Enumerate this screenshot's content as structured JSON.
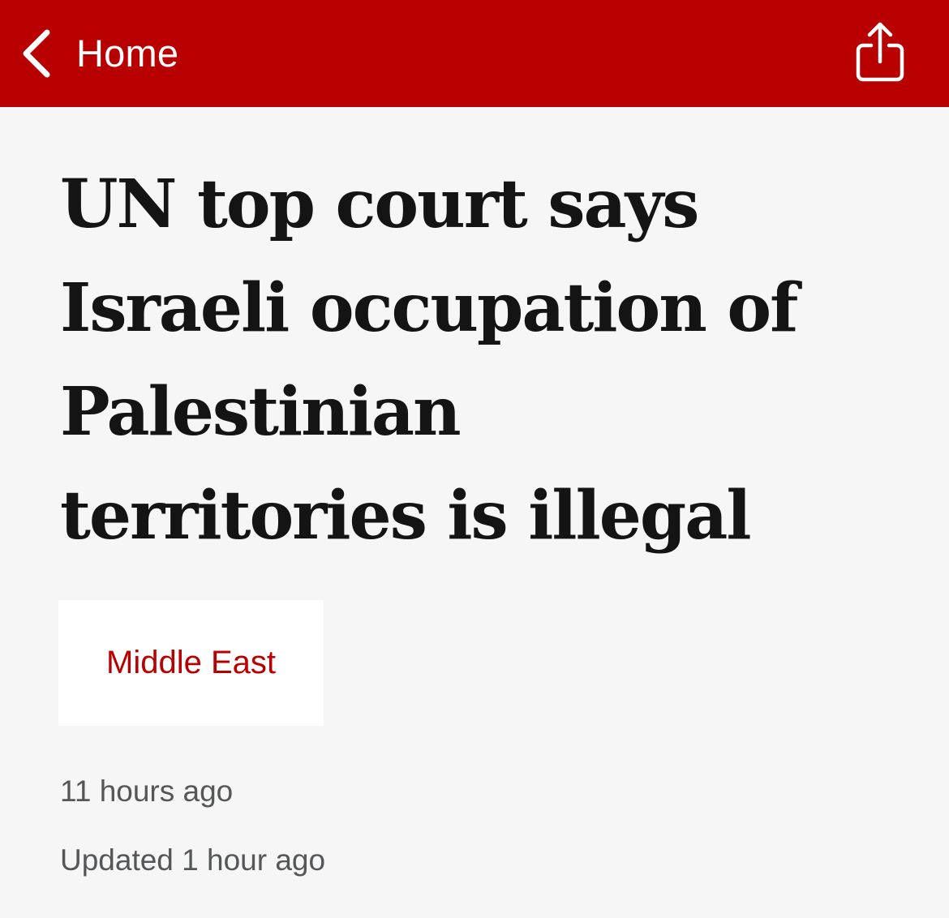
{
  "nav": {
    "back_label": "Home",
    "back_icon": "chevron-left-icon",
    "share_icon": "share-icon"
  },
  "article": {
    "headline_lines": [
      "UN top court says",
      "Israeli occupation of",
      "Palestinian",
      "territories is illegal"
    ],
    "topic": "Middle East",
    "published": "11 hours ago",
    "updated": "Updated 1 hour ago"
  },
  "colors": {
    "brand_red": "#b80000",
    "background": "#f6f6f6",
    "headline_text": "#141414",
    "meta_text": "#545658",
    "card_background": "#ffffff"
  }
}
